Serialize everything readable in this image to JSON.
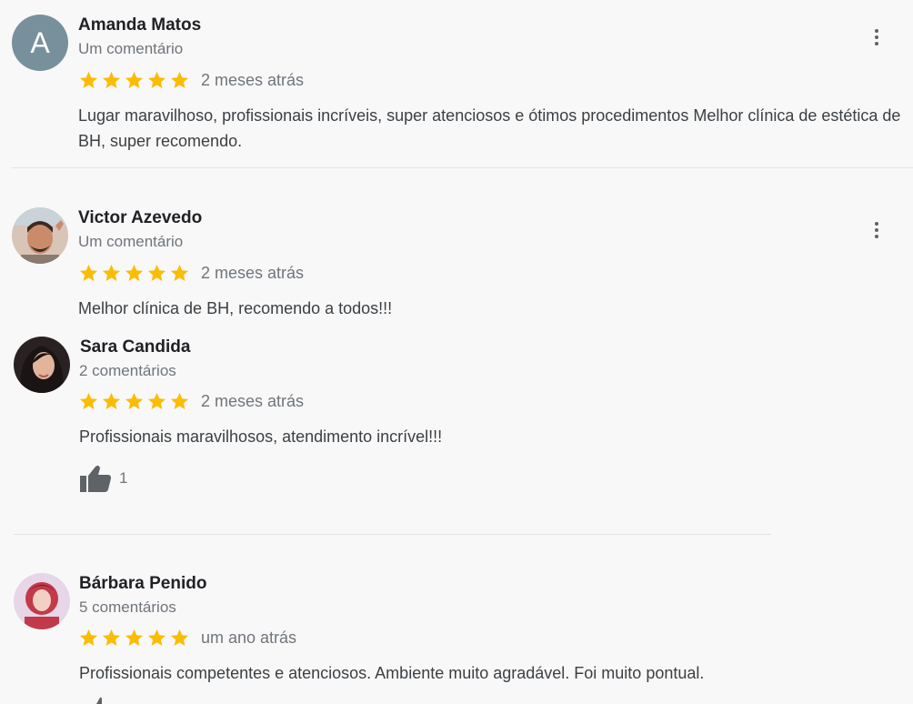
{
  "colors": {
    "star": "#fbbc04",
    "text": "#3c4043",
    "meta": "#70757a"
  },
  "reviews": [
    {
      "avatar_letter": "A",
      "name": "Amanda Matos",
      "meta": "Um comentário",
      "rating": 5,
      "time": "2 meses atrás",
      "text": "Lugar maravilhoso, profissionais incríveis, super atenciosos e ótimos procedimentos Melhor clínica de estética de BH, super recomendo."
    },
    {
      "name": "Victor Azevedo",
      "meta": "Um comentário",
      "rating": 5,
      "time": "2 meses atrás",
      "text": "Melhor clínica de BH, recomendo a todos!!!"
    },
    {
      "name": "Sara Candida",
      "meta": "2 comentários",
      "rating": 5,
      "time": "2 meses atrás",
      "text": "Profissionais maravilhosos, atendimento incrível!!!",
      "likes": "1"
    },
    {
      "name": "Bárbara Penido",
      "meta": "5 comentários",
      "rating": 5,
      "time": "um ano atrás",
      "text": "Profissionais competentes e atenciosos. Ambiente muito agradável. Foi muito pontual."
    }
  ]
}
